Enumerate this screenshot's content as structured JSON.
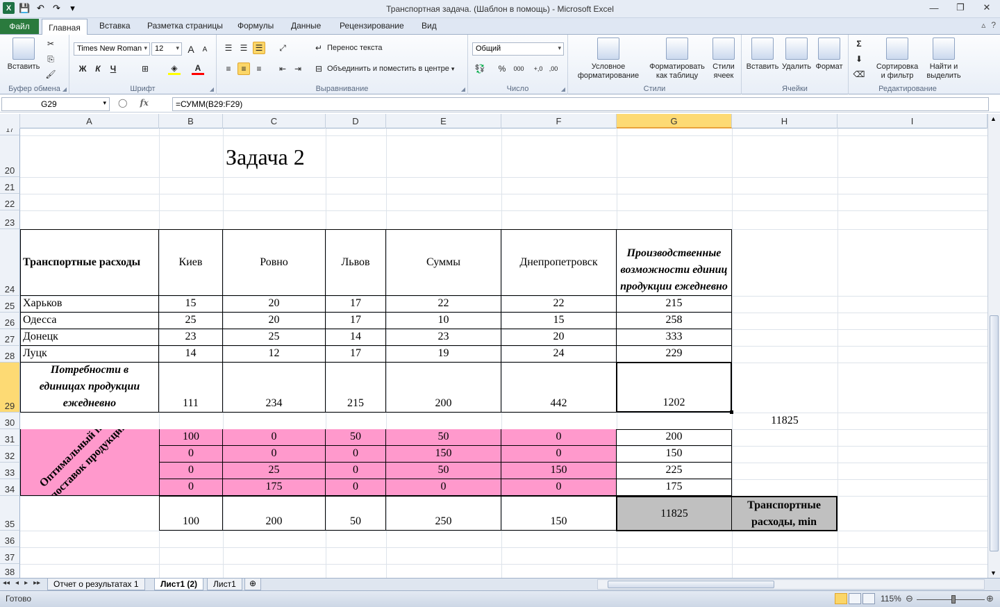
{
  "window": {
    "title": "Транспортная задача. (Шаблон в помощь)  -  Microsoft Excel",
    "minimize": "—",
    "restore": "❐",
    "close": "✕"
  },
  "qat": {
    "logo": "X",
    "save": "💾",
    "undo": "↶",
    "redo": "↷",
    "more": "▾"
  },
  "ribbon_tabs": {
    "file": "Файл",
    "home": "Главная",
    "insert": "Вставка",
    "layout": "Разметка страницы",
    "formulas": "Формулы",
    "data": "Данные",
    "review": "Рецензирование",
    "view": "Вид",
    "help": "?",
    "minimize": "▵"
  },
  "ribbon": {
    "clipboard": {
      "label": "Буфер обмена",
      "paste": "Вставить"
    },
    "font": {
      "label": "Шрифт",
      "name": "Times New Roman",
      "size": "12",
      "bold": "Ж",
      "italic": "К",
      "underline": "Ч",
      "grow": "A",
      "shrink": "A"
    },
    "alignment": {
      "label": "Выравнивание",
      "wrap": "Перенос текста",
      "merge": "Объединить и поместить в центре"
    },
    "number": {
      "label": "Число",
      "format": "Общий",
      "percent": "%",
      "thousands": "000",
      "inc": "+,0",
      "dec": ",00"
    },
    "styles": {
      "label": "Стили",
      "cond_line1": "Условное",
      "cond_line2": "форматирование",
      "table_line1": "Форматировать",
      "table_line2": "как таблицу",
      "cell_line1": "Стили",
      "cell_line2": "ячеек"
    },
    "cells": {
      "label": "Ячейки",
      "insert": "Вставить",
      "delete": "Удалить",
      "format": "Формат"
    },
    "editing": {
      "label": "Редактирование",
      "sum": "Σ",
      "sort_line1": "Сортировка",
      "sort_line2": "и фильтр",
      "find_line1": "Найти и",
      "find_line2": "выделить"
    }
  },
  "formula_bar": {
    "name_box": "G29",
    "fx": "fx",
    "formula": "=СУММ(B29:F29)"
  },
  "columns": [
    "A",
    "B",
    "C",
    "D",
    "E",
    "F",
    "G",
    "H",
    "I"
  ],
  "selected_column": "G",
  "rows": [
    "17",
    "20",
    "21",
    "22",
    "23",
    "24",
    "25",
    "26",
    "27",
    "28",
    "29",
    "30",
    "31",
    "32",
    "33",
    "34",
    "35",
    "36",
    "37",
    "38"
  ],
  "selected_row": "29",
  "sheet": {
    "title": "Задача 2",
    "header": {
      "a": "Транспортные расходы",
      "b": "Киев",
      "c": "Ровно",
      "d": "Львов",
      "e": "Суммы",
      "f": "Днепропетровск",
      "g": "Производственные возможности единиц продукции ежедневно"
    },
    "cost_rows": [
      {
        "name": "Харьков",
        "vals": [
          "15",
          "20",
          "17",
          "22",
          "22",
          "215"
        ]
      },
      {
        "name": "Одесса",
        "vals": [
          "25",
          "20",
          "17",
          "10",
          "15",
          "258"
        ]
      },
      {
        "name": "Донецк",
        "vals": [
          "23",
          "25",
          "14",
          "23",
          "20",
          "333"
        ]
      },
      {
        "name": "Луцк",
        "vals": [
          "14",
          "12",
          "17",
          "19",
          "24",
          "229"
        ]
      }
    ],
    "demand": {
      "label": "Потребности в единицах продукции ежедневно",
      "vals": [
        "111",
        "234",
        "215",
        "200",
        "442",
        "1202"
      ]
    },
    "h30": "11825",
    "plan_label": "Оптимальный план поставок продукции",
    "plan_rows": [
      [
        "100",
        "0",
        "50",
        "50",
        "0",
        "200"
      ],
      [
        "0",
        "0",
        "0",
        "150",
        "0",
        "150"
      ],
      [
        "0",
        "25",
        "0",
        "50",
        "150",
        "225"
      ],
      [
        "0",
        "175",
        "0",
        "0",
        "0",
        "175"
      ]
    ],
    "totals": [
      "100",
      "200",
      "50",
      "250",
      "150"
    ],
    "g35": "11825",
    "h35": "Транспортные расходы, min"
  },
  "sheet_tabs": {
    "nav": [
      "◂◂",
      "◂",
      "▸",
      "▸▸"
    ],
    "tab1": "Отчет о результатах 1",
    "tab2": "Лист1 (2)",
    "tab3": "Лист1",
    "new": "⊕"
  },
  "status": {
    "ready": "Готово",
    "zoom": "115%",
    "minus": "⊖",
    "plus": "⊕"
  }
}
